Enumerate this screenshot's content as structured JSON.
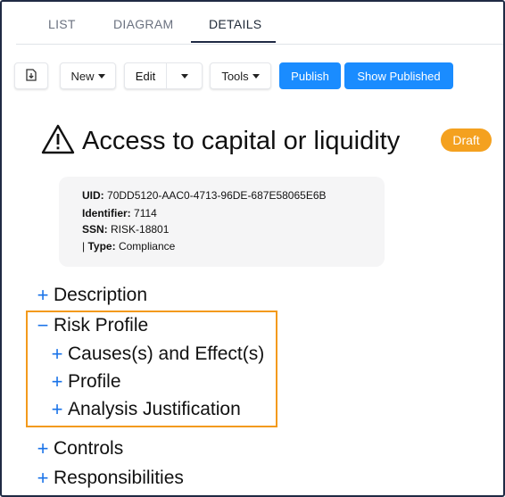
{
  "tabs": [
    {
      "label": "LIST",
      "active": false
    },
    {
      "label": "DIAGRAM",
      "active": false
    },
    {
      "label": "DETAILS",
      "active": true
    }
  ],
  "toolbar": {
    "export_icon": "file-download-icon",
    "new_label": "New",
    "edit_label": "Edit",
    "tools_label": "Tools",
    "publish_label": "Publish",
    "show_published_label": "Show Published"
  },
  "record": {
    "title": "Access to capital or liquidity",
    "title_icon": "warning-triangle-icon",
    "status": "Draft",
    "status_color": "#f4a11f",
    "info": {
      "uid_label": "UID:",
      "uid": "70DD5120-AAC0-4713-96DE-687E58065E6B",
      "identifier_label": "Identifier:",
      "identifier": "7114",
      "ssn_label": "SSN:",
      "ssn": "RISK-18801",
      "type_prefix": "|",
      "type_label": "Type:",
      "type": "Compliance"
    }
  },
  "tree": {
    "description": {
      "symbol": "+",
      "label": "Description"
    },
    "risk_profile": {
      "symbol": "−",
      "label": "Risk Profile"
    },
    "causes_effects": {
      "symbol": "+",
      "label": "Causes(s) and Effect(s)"
    },
    "profile": {
      "symbol": "+",
      "label": "Profile"
    },
    "analysis_justification": {
      "symbol": "+",
      "label": "Analysis Justification"
    },
    "controls": {
      "symbol": "+",
      "label": "Controls"
    },
    "responsibilities": {
      "symbol": "+",
      "label": "Responsibilities"
    }
  },
  "colors": {
    "accent": "#1a8cff",
    "tree_symbol": "#1a73e8",
    "highlight": "#f39a1c"
  }
}
